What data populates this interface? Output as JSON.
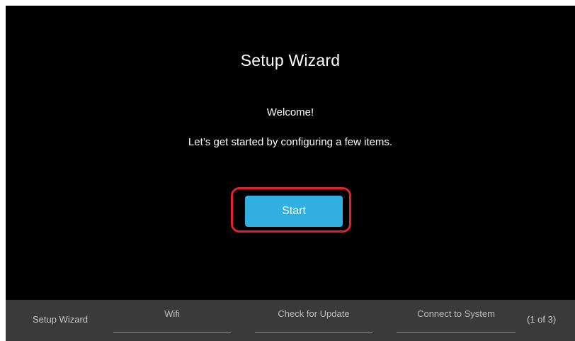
{
  "wizard": {
    "title": "Setup Wizard",
    "welcome": "Welcome!",
    "subtitle": "Let’s get started by configuring a few items.",
    "start_label": "Start"
  },
  "footer": {
    "steps": [
      {
        "label": "Setup Wizard"
      },
      {
        "label": "Wifi"
      },
      {
        "label": "Check for Update"
      },
      {
        "label": "Connect to System"
      }
    ],
    "page_indicator": "(1 of 3)"
  },
  "colors": {
    "background": "#000000",
    "footer_background": "#3a3a3a",
    "button": "#2fb0e0",
    "highlight": "#e3202c",
    "text": "#ffffff",
    "footer_text": "#bdbdbd"
  }
}
